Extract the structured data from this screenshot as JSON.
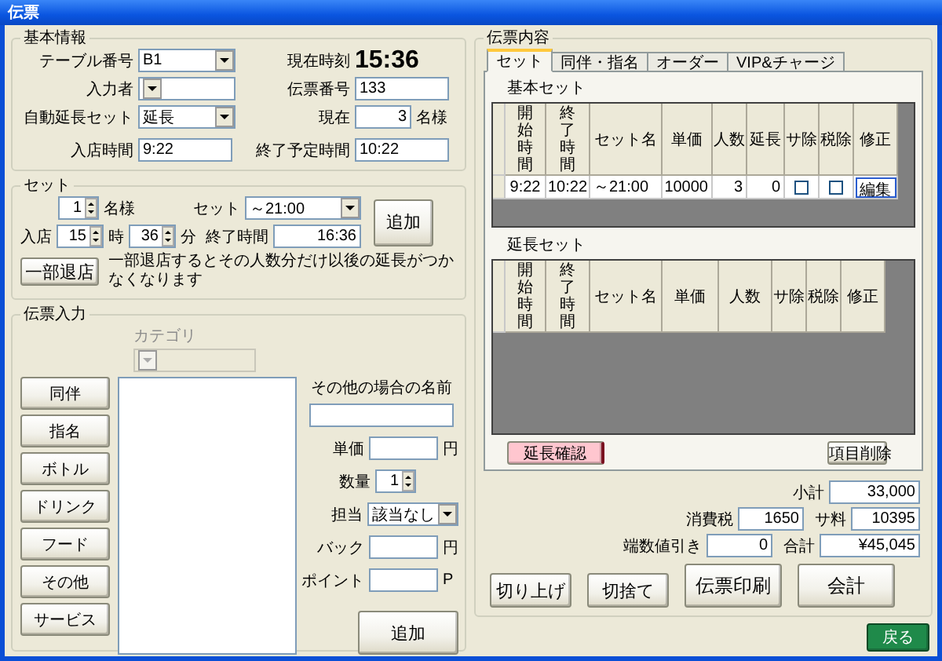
{
  "window": {
    "title": "伝票"
  },
  "basic_info": {
    "title": "基本情報",
    "table_number": {
      "label": "テーブル番号",
      "value": "B1"
    },
    "entered_by": {
      "label": "入力者"
    },
    "auto_extension_set": {
      "label": "自動延長セット",
      "value": "延長"
    },
    "current_time": {
      "label": "現在時刻",
      "value": "15:36"
    },
    "slip_number": {
      "label": "伝票番号",
      "value": "133"
    },
    "current_count": {
      "label": "現在",
      "value": "3",
      "unit": "名様"
    },
    "entry_time": {
      "label": "入店時間",
      "value": "9:22"
    },
    "planned_end": {
      "label": "終了予定時間",
      "value": "10:22"
    }
  },
  "set": {
    "title": "セット",
    "guests": {
      "value": "1",
      "unit": "名様"
    },
    "set_select": {
      "label": "セット",
      "value": "～21:00"
    },
    "entry": {
      "label": "入店",
      "hour": "15",
      "hour_unit": "時",
      "minute": "36",
      "minute_unit": "分"
    },
    "end_time": {
      "label": "終了時間",
      "value": "16:36"
    },
    "add_button": "追加",
    "partial_leave_button": "一部退店",
    "note": "一部退店するとその人数分だけ以後の延長がつかなくなります"
  },
  "slip_entry": {
    "title": "伝票入力",
    "category": {
      "label": "カテゴリ",
      "disabled": true
    },
    "category_buttons": [
      "同伴",
      "指名",
      "ボトル",
      "ドリンク",
      "フード",
      "その他",
      "サービス"
    ],
    "other_name": {
      "label": "その他の場合の名前"
    },
    "unit_price": {
      "label": "単価",
      "unit": "円"
    },
    "quantity": {
      "label": "数量",
      "value": "1"
    },
    "staff": {
      "label": "担当",
      "value": "該当なし"
    },
    "back": {
      "label": "バック",
      "unit": "円"
    },
    "points": {
      "label": "ポイント",
      "unit": "P"
    },
    "add_button": "追加"
  },
  "slip_contents": {
    "title": "伝票内容",
    "tabs": [
      {
        "label": "セット",
        "selected": true
      },
      {
        "label": "同伴・指名",
        "selected": false
      },
      {
        "label": "オーダー",
        "selected": false
      },
      {
        "label": "VIP&チャージ",
        "selected": false
      }
    ],
    "basic_set": {
      "title": "基本セット",
      "columns": [
        {
          "label": "開始時間",
          "kind": "vertical"
        },
        {
          "label": "終了時間",
          "kind": "vertical"
        },
        {
          "label": "セット名",
          "kind": "horizontal"
        },
        {
          "label": "単価",
          "kind": "horizontal"
        },
        {
          "label": "人数",
          "kind": "horizontal"
        },
        {
          "label": "延長",
          "kind": "horizontal"
        },
        {
          "label": "サ除",
          "kind": "horizontal"
        },
        {
          "label": "税除",
          "kind": "horizontal"
        },
        {
          "label": "修正",
          "kind": "horizontal"
        }
      ],
      "rows": [
        {
          "cells": [
            {
              "kind": "text",
              "value": "9:22"
            },
            {
              "kind": "text",
              "value": "10:22"
            },
            {
              "kind": "text",
              "value": "～21:00"
            },
            {
              "kind": "text",
              "value": "10000"
            },
            {
              "kind": "text",
              "value": "3"
            },
            {
              "kind": "text",
              "value": "0"
            },
            {
              "kind": "checkbox",
              "checked": false
            },
            {
              "kind": "checkbox",
              "checked": false
            },
            {
              "kind": "button",
              "label": "編集"
            }
          ]
        }
      ]
    },
    "extension_set": {
      "title": "延長セット",
      "columns": [
        {
          "label": "開始時間",
          "kind": "vertical"
        },
        {
          "label": "終了時間",
          "kind": "vertical"
        },
        {
          "label": "セット名",
          "kind": "horizontal"
        },
        {
          "label": "単価",
          "kind": "horizontal"
        },
        {
          "label": "人数",
          "kind": "horizontal"
        },
        {
          "label": "サ除",
          "kind": "horizontal"
        },
        {
          "label": "税除",
          "kind": "horizontal"
        },
        {
          "label": "修正",
          "kind": "horizontal"
        }
      ]
    },
    "confirm_extension_button": "延長確認",
    "delete_item_button": "項目削除",
    "totals": {
      "subtotal": {
        "label": "小計",
        "value": "33,000"
      },
      "consumption_tax": {
        "label": "消費税",
        "value": "1650"
      },
      "service_charge": {
        "label": "サ料",
        "value": "10395"
      },
      "rounding_discount": {
        "label": "端数値引き",
        "value": "0"
      },
      "total": {
        "label": "合計",
        "value": "¥45,045"
      }
    },
    "actions": [
      "切り上げ",
      "切捨て",
      "伝票印刷",
      "会計"
    ]
  },
  "back_button": "戻る"
}
